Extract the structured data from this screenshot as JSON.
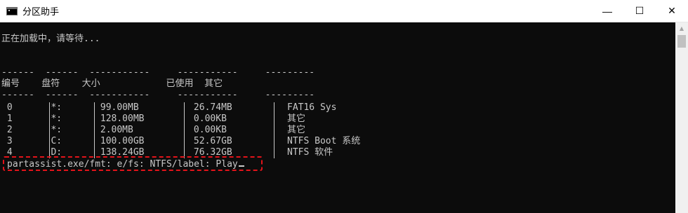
{
  "window": {
    "title": "分区助手",
    "icon": "console-icon",
    "controls": {
      "minimize": "—",
      "maximize": "☐",
      "close": "✕"
    }
  },
  "console": {
    "loading": "正在加载中，请等待...",
    "dash_row": "------  ------  -----------     -----------     ---------",
    "header_row": "编号    盘符    大小            已使用  其它",
    "dash_row_2": "------  ------  -----------     -----------     ---------",
    "rows": [
      " 0       *:       99.00MB          26.74MB          FAT16 Sys",
      " 1       *:       128.00MB         0.00KB           其它",
      " 2       *:       2.00MB           0.00KB           其它",
      " 3       C:       100.00GB         52.67GB          NTFS Boot 系统",
      " 4       D:       138.24GB         76.32GB          NTFS 软件"
    ],
    "command": "partassist.exe/fmt: e/fs: NTFS/label: Play"
  },
  "colors": {
    "console_bg": "#0c0c0c",
    "console_text": "#c8c8c8",
    "highlight": "#e3131a"
  }
}
